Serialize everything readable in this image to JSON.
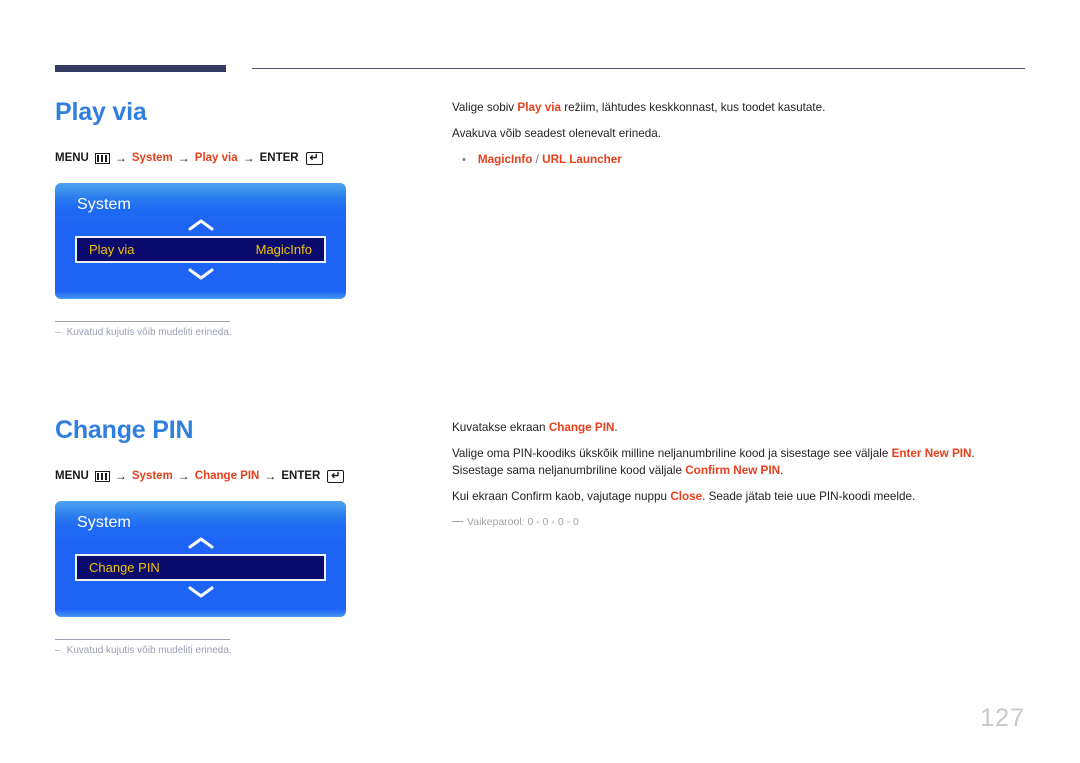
{
  "document": {
    "page_number": "127"
  },
  "sections": [
    {
      "id": "play-via",
      "title": "Play via",
      "breadcrumb": {
        "menu_label": "MENU",
        "menu_icon": "menu-grid-icon",
        "arrow": "→",
        "path": [
          "System",
          "Play via"
        ],
        "enter_label": "ENTER",
        "enter_icon": "enter-return-icon"
      },
      "osd": {
        "title": "System",
        "up_icon": "chevron-up-icon",
        "down_icon": "chevron-down-icon",
        "row_label": "Play via",
        "row_value": "MagicInfo"
      },
      "note": {
        "dash": "–",
        "text": "Kuvatud kujutis võib mudeliti erineda."
      },
      "body": [
        {
          "parts": [
            {
              "text": "Valige sobiv ",
              "style": "normal"
            },
            {
              "text": "Play via",
              "style": "highlight"
            },
            {
              "text": " režiim, lähtudes keskkonnast, kus toodet kasutate.",
              "style": "normal"
            }
          ]
        },
        {
          "parts": [
            {
              "text": "Avakuva võib seadest olenevalt erineda.",
              "style": "normal"
            }
          ]
        }
      ],
      "bullets": [
        {
          "dot": "•",
          "parts": [
            {
              "text": "MagicInfo",
              "style": "highlight"
            },
            {
              "text": " / ",
              "style": "sep"
            },
            {
              "text": "URL Launcher",
              "style": "highlight"
            }
          ]
        }
      ],
      "small_notes": []
    },
    {
      "id": "change-pin",
      "title": "Change PIN",
      "breadcrumb": {
        "menu_label": "MENU",
        "menu_icon": "menu-grid-icon",
        "arrow": "→",
        "path": [
          "System",
          "Change PIN"
        ],
        "enter_label": "ENTER",
        "enter_icon": "enter-return-icon"
      },
      "osd": {
        "title": "System",
        "up_icon": "chevron-up-icon",
        "down_icon": "chevron-down-icon",
        "row_label": "Change PIN",
        "row_value": ""
      },
      "note": {
        "dash": "–",
        "text": "Kuvatud kujutis võib mudeliti erineda."
      },
      "body": [
        {
          "parts": [
            {
              "text": "Kuvatakse ekraan ",
              "style": "normal"
            },
            {
              "text": "Change PIN",
              "style": "highlight"
            },
            {
              "text": ".",
              "style": "normal"
            }
          ]
        },
        {
          "parts": [
            {
              "text": "Valige oma PIN-koodiks ükskõik milline neljanumbriline kood ja sisestage see väljale ",
              "style": "normal"
            },
            {
              "text": "Enter New PIN",
              "style": "highlight"
            },
            {
              "text": ". Sisestage sama neljanumbriline kood väljale ",
              "style": "normal"
            },
            {
              "text": "Confirm New PIN",
              "style": "highlight"
            },
            {
              "text": ".",
              "style": "normal"
            }
          ]
        },
        {
          "parts": [
            {
              "text": "Kui ekraan Confirm kaob, vajutage nuppu ",
              "style": "normal"
            },
            {
              "text": "Close",
              "style": "highlight"
            },
            {
              "text": ". Seade jätab teie uue PIN-koodi meelde.",
              "style": "normal"
            }
          ]
        }
      ],
      "bullets": [],
      "small_notes": [
        {
          "text": "Vaikeparool: 0 - 0 - 0 - 0"
        }
      ]
    }
  ],
  "colors": {
    "heading_blue": "#2f7fe0",
    "highlight_red": "#e8401c",
    "osd_blue": "#1d63f4",
    "osd_row_navy": "#0b0b6e",
    "osd_row_gold": "#f2c200",
    "rule_navy": "#343b5e",
    "page_number_gray": "#c8c8c8"
  }
}
